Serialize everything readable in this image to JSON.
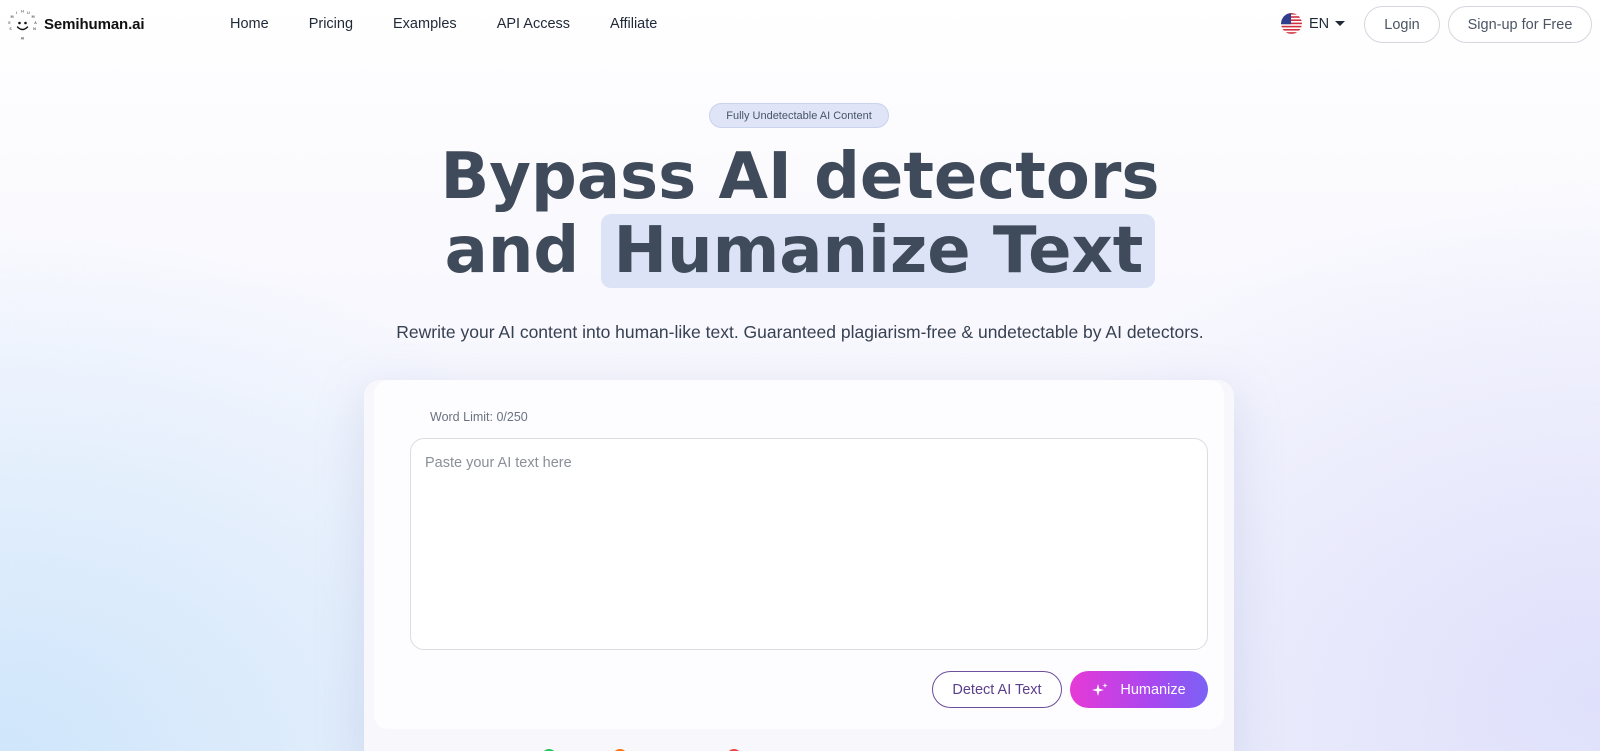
{
  "brand": {
    "name": "Semihuman.ai"
  },
  "nav": {
    "items": [
      {
        "label": "Home"
      },
      {
        "label": "Pricing"
      },
      {
        "label": "Examples"
      },
      {
        "label": "API Access"
      },
      {
        "label": "Affiliate"
      }
    ]
  },
  "header": {
    "language": "EN",
    "language_icon": "us-flag-icon",
    "login_label": "Login",
    "signup_label": "Sign-up for Free"
  },
  "hero": {
    "badge": "Fully Undetectable AI Content",
    "headline_line1": "Bypass AI detectors",
    "headline_line2_prefix": "and ",
    "headline_line2_highlight": "Humanize Text",
    "subtitle": "Rewrite your AI content into human-like text. Guaranteed plagiarism-free & undetectable by AI detectors."
  },
  "editor": {
    "word_limit": "Word Limit: 0/250",
    "input_value": "",
    "input_placeholder": "Paste your AI text here",
    "detect_label": "Detect AI Text",
    "humanize_label": "Humanize",
    "humanize_icon": "sparkle-icon"
  },
  "colors": {
    "accent_gradient_start": "#e63ad6",
    "accent_gradient_end": "#7a62f5",
    "headline": "#3f4a5a",
    "highlight": "#dde3f6",
    "status_green": "#22c55e",
    "status_orange": "#f97316",
    "status_red": "#ef4444"
  }
}
